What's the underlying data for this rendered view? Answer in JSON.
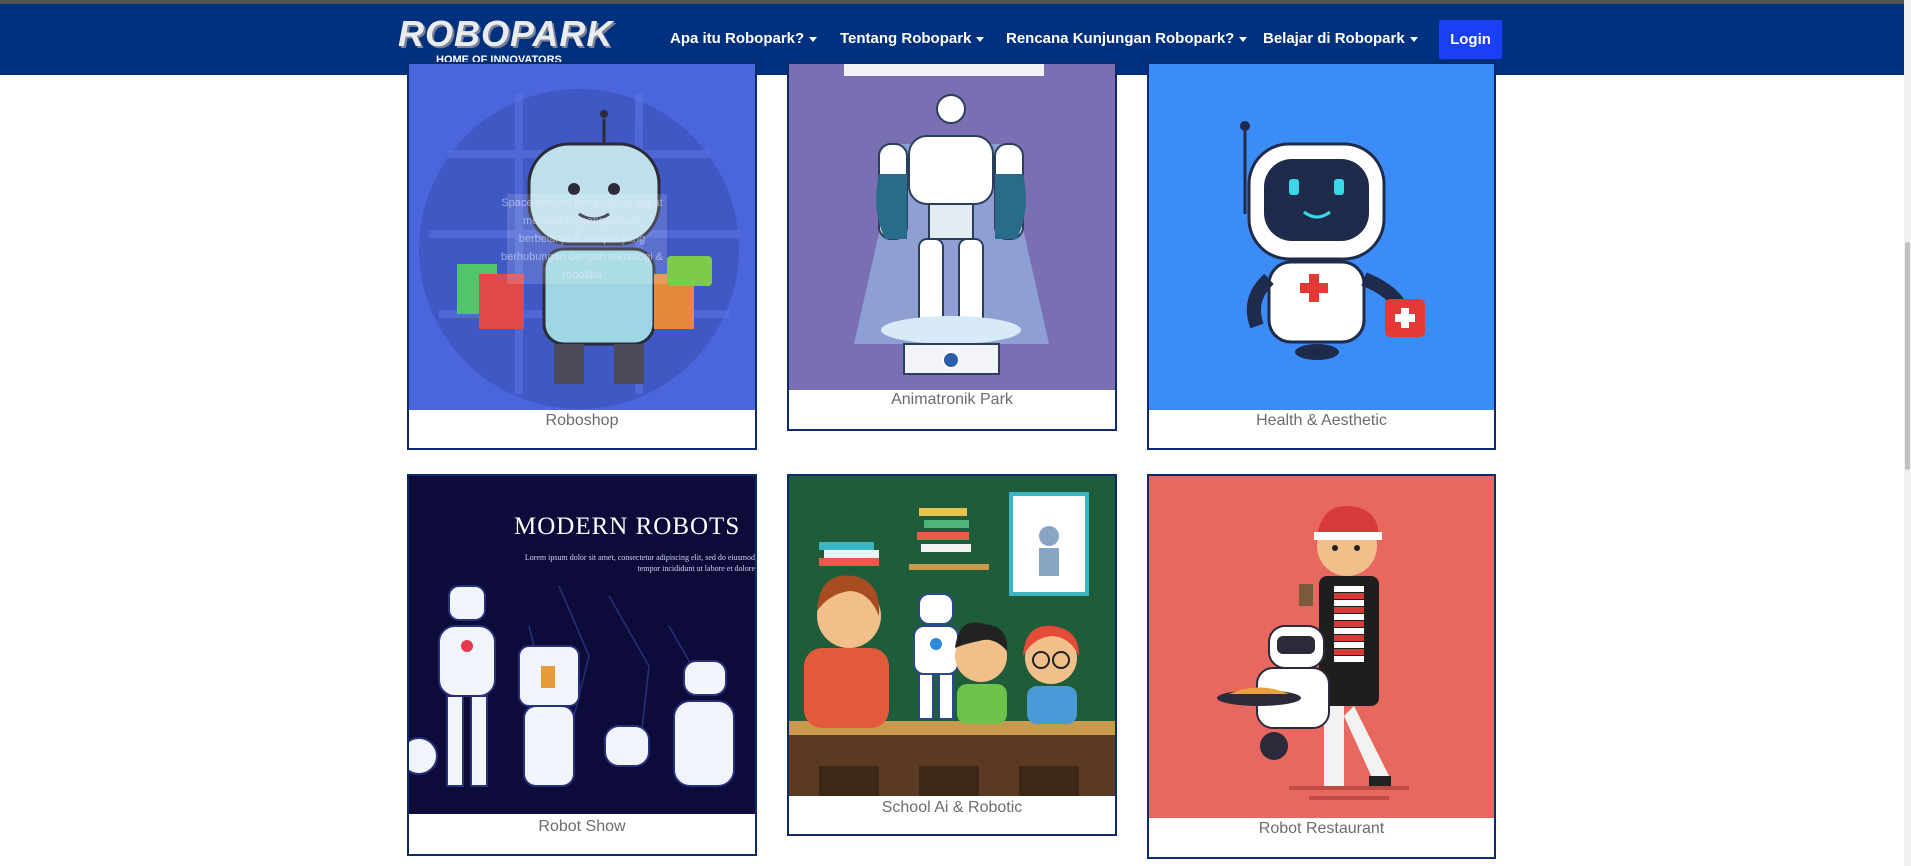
{
  "header": {
    "logo_text": "ROBOPARK",
    "logo_tagline": "HOME OF INNOVATORS",
    "nav": [
      {
        "label": "Apa itu Robopark?"
      },
      {
        "label": "Tentang Robopark"
      },
      {
        "label": "Rencana Kunjungan Robopark?"
      },
      {
        "label": "Belajar di Robopark"
      }
    ],
    "login_label": "Login"
  },
  "cards": [
    {
      "label": "Roboshop",
      "overlay_text": "Space dimana pengunjung dapat merasakan pengalaman berbelanja di tempat yang berhubungan dengan teknologi & robotika"
    },
    {
      "label": "Animatronik Park"
    },
    {
      "label": "Health & Aesthetic"
    },
    {
      "label": "Robot Show",
      "poster_title": "MODERN ROBOTS",
      "poster_body_1": "Lorem ipsum dolor sit amet, consectetur adipiscing elit, sed do eiusmod",
      "poster_body_2": "tempor incididunt ut labore et dolore"
    },
    {
      "label": "School Ai & Robotic"
    },
    {
      "label": "Robot Restaurant"
    }
  ],
  "colors": {
    "navbar": "#00317f",
    "login": "#1a3ff5",
    "card_border": "#0d2b6b",
    "roboshop_bg": "#4b66dc",
    "animatronik_bg": "#7b6fb3",
    "health_bg": "#3b8cf6",
    "robotshow_bg": "#0c0b3a",
    "school_bg": "#1f5c3a",
    "restaurant_bg": "#e8675f"
  },
  "icons": [
    "caret-down-icon"
  ]
}
